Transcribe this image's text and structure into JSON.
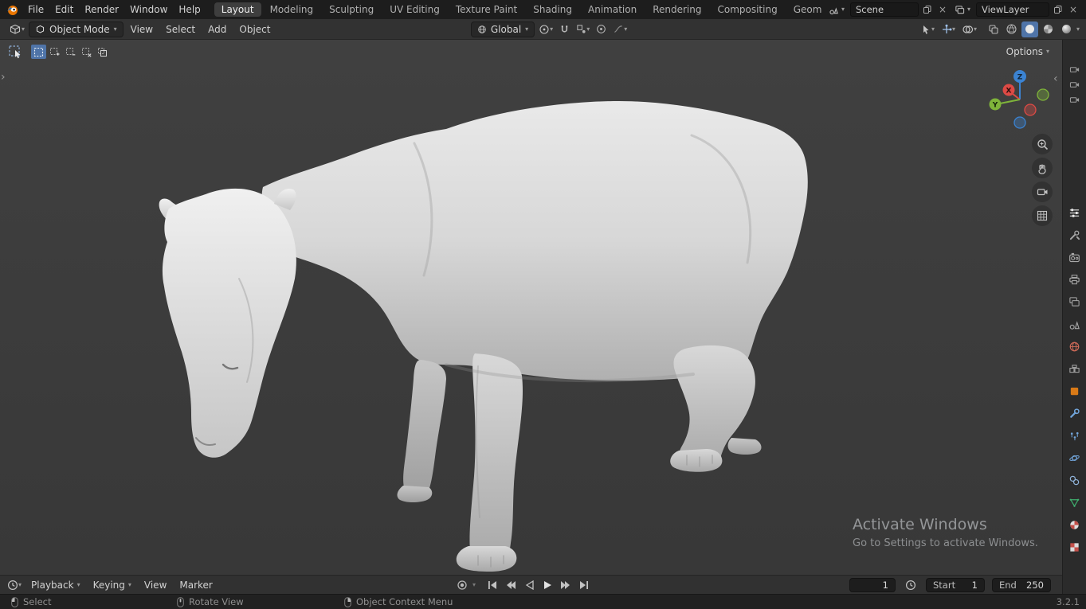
{
  "icons": {
    "dropdown": "▾",
    "close": "×",
    "chevron-right": "›",
    "chevron-left": "‹"
  },
  "topbar": {
    "menus": [
      {
        "label": "File"
      },
      {
        "label": "Edit"
      },
      {
        "label": "Render"
      },
      {
        "label": "Window"
      },
      {
        "label": "Help"
      }
    ],
    "workspaces": [
      {
        "label": "Layout",
        "active": true
      },
      {
        "label": "Modeling"
      },
      {
        "label": "Sculpting"
      },
      {
        "label": "UV Editing"
      },
      {
        "label": "Texture Paint"
      },
      {
        "label": "Shading"
      },
      {
        "label": "Animation"
      },
      {
        "label": "Rendering"
      },
      {
        "label": "Compositing"
      },
      {
        "label": "Geometry Noc"
      }
    ],
    "scene_field": {
      "value": "Scene"
    },
    "view_layer_field": {
      "value": "ViewLayer"
    }
  },
  "viewport_header": {
    "mode_selector": "Object Mode",
    "menus": [
      {
        "label": "View"
      },
      {
        "label": "Select"
      },
      {
        "label": "Add"
      },
      {
        "label": "Object"
      }
    ],
    "transform_orientation": "Global",
    "options_button": "Options"
  },
  "viewport": {
    "gizmo": {
      "x": "X",
      "y": "Y",
      "z": "Z"
    },
    "watermark_line1": "Activate Windows",
    "watermark_line2": "Go to Settings to activate Windows."
  },
  "properties_tabs": [
    "tool",
    "render",
    "output",
    "view-layer",
    "scene",
    "world",
    "collection",
    "object",
    "modifiers",
    "particles",
    "physics",
    "constraints",
    "object-data",
    "material",
    "texture"
  ],
  "timeline": {
    "menus": [
      {
        "label": "Playback"
      },
      {
        "label": "Keying"
      },
      {
        "label": "View"
      },
      {
        "label": "Marker"
      }
    ],
    "current_frame": "1",
    "start": {
      "label": "Start",
      "value": "1"
    },
    "end": {
      "label": "End",
      "value": "250"
    }
  },
  "statusbar": {
    "hints": [
      {
        "label": "Select"
      },
      {
        "label": "Rotate View"
      },
      {
        "label": "Object Context Menu"
      }
    ],
    "version": "3.2.1"
  },
  "colors": {
    "accent": "#4f74a8",
    "header_bg": "#1d1d1d",
    "toolbar_bg": "#323232",
    "viewport_bg": "#3c3c3c",
    "model_color": "#d6d6d6",
    "axis_x": "#dd4a45",
    "axis_y": "#7fb43a",
    "axis_z": "#3b83d2",
    "object_tab_orange": "#d97a17",
    "modifier_blue": "#71a4d9",
    "material_red": "#c4504a",
    "data_green": "#3fae6e"
  }
}
